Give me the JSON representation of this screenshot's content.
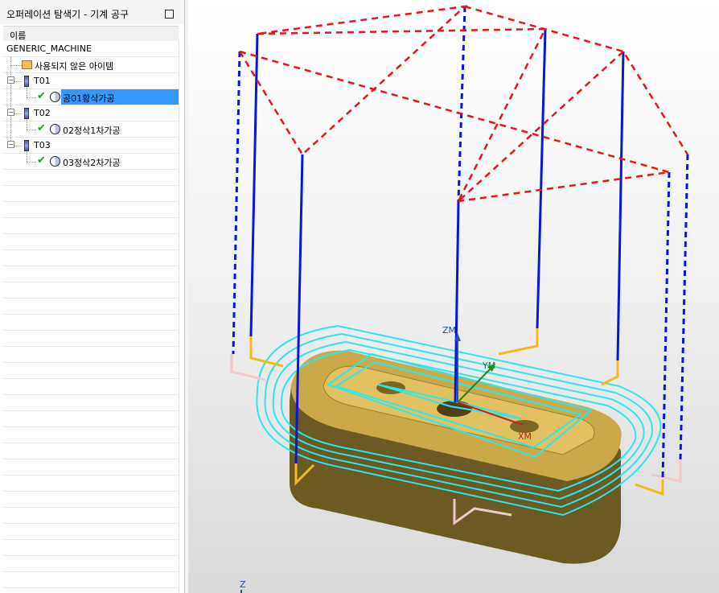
{
  "panel": {
    "title": "오퍼레이션 탐색기 - 기계 공구",
    "column_header": "이름",
    "tree": {
      "root": "GENERIC_MACHINE",
      "unused_items": "사용되지 않은 아이템",
      "tools": [
        {
          "name": "T01",
          "operation": "공01황삭가공",
          "selected": true
        },
        {
          "name": "T02",
          "operation": "02정삭1차가공",
          "selected": false
        },
        {
          "name": "T03",
          "operation": "03정삭2차가공",
          "selected": false
        }
      ]
    }
  },
  "viewport": {
    "axes": {
      "z": "ZM",
      "y": "YM",
      "x": "XM"
    },
    "triad_label": "Z",
    "colors": {
      "rapid": "#e8151b",
      "engage": "#0a16d4",
      "cut": "#2ee6ea",
      "lead": "#f2b81c",
      "retract": "#f0c8c8",
      "part": "#c9a94a"
    }
  }
}
